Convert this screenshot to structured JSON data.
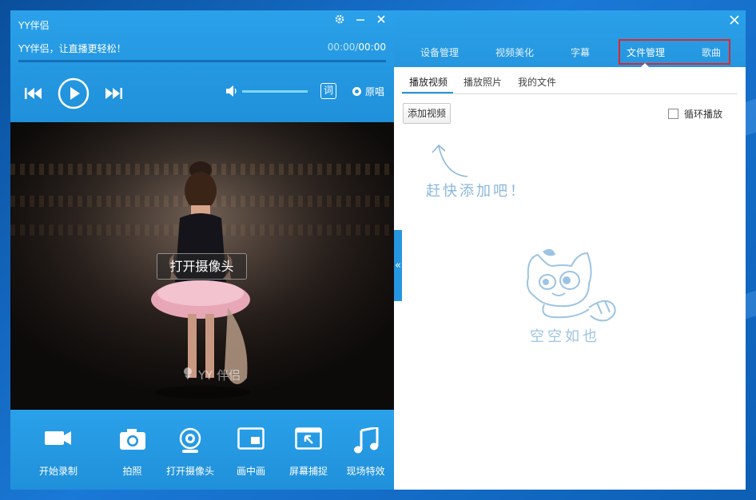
{
  "player": {
    "title": "YY伴侣",
    "subtitle": "YY伴侣，让直播更轻松！",
    "time_current": "00:00",
    "time_separator": "/",
    "time_total": "00:00",
    "progress": 0,
    "volume": 1.0,
    "lyric_label": "词",
    "original_label": "原唱"
  },
  "video": {
    "open_camera_label": "打开摄像头",
    "watermark": "YY 伴侣"
  },
  "tools": [
    {
      "label": "开始录制",
      "icon": "video-camera-icon"
    },
    {
      "label": "拍照",
      "icon": "photo-camera-icon"
    },
    {
      "label": "打开摄像头",
      "icon": "webcam-icon"
    },
    {
      "label": "画中画",
      "icon": "picture-in-picture-icon"
    },
    {
      "label": "屏幕捕捉",
      "icon": "screen-capture-icon"
    },
    {
      "label": "现场特效",
      "icon": "music-note-icon"
    }
  ],
  "collapse_label": "«",
  "panel": {
    "tabs": [
      {
        "label": "设备管理"
      },
      {
        "label": "视频美化"
      },
      {
        "label": "字幕"
      },
      {
        "label": "文件管理"
      },
      {
        "label": "歌曲"
      }
    ],
    "active_tab": "文件管理",
    "subtabs": [
      {
        "label": "播放视频"
      },
      {
        "label": "播放照片"
      },
      {
        "label": "我的文件"
      }
    ],
    "add_video_label": "添加视频",
    "loop_label": "循环播放",
    "loop_checked": false,
    "hint_text": "赶快添加吧！",
    "empty_text": "空空如也"
  },
  "colors": {
    "accent": "#2596df",
    "highlight": "#e0262b"
  }
}
